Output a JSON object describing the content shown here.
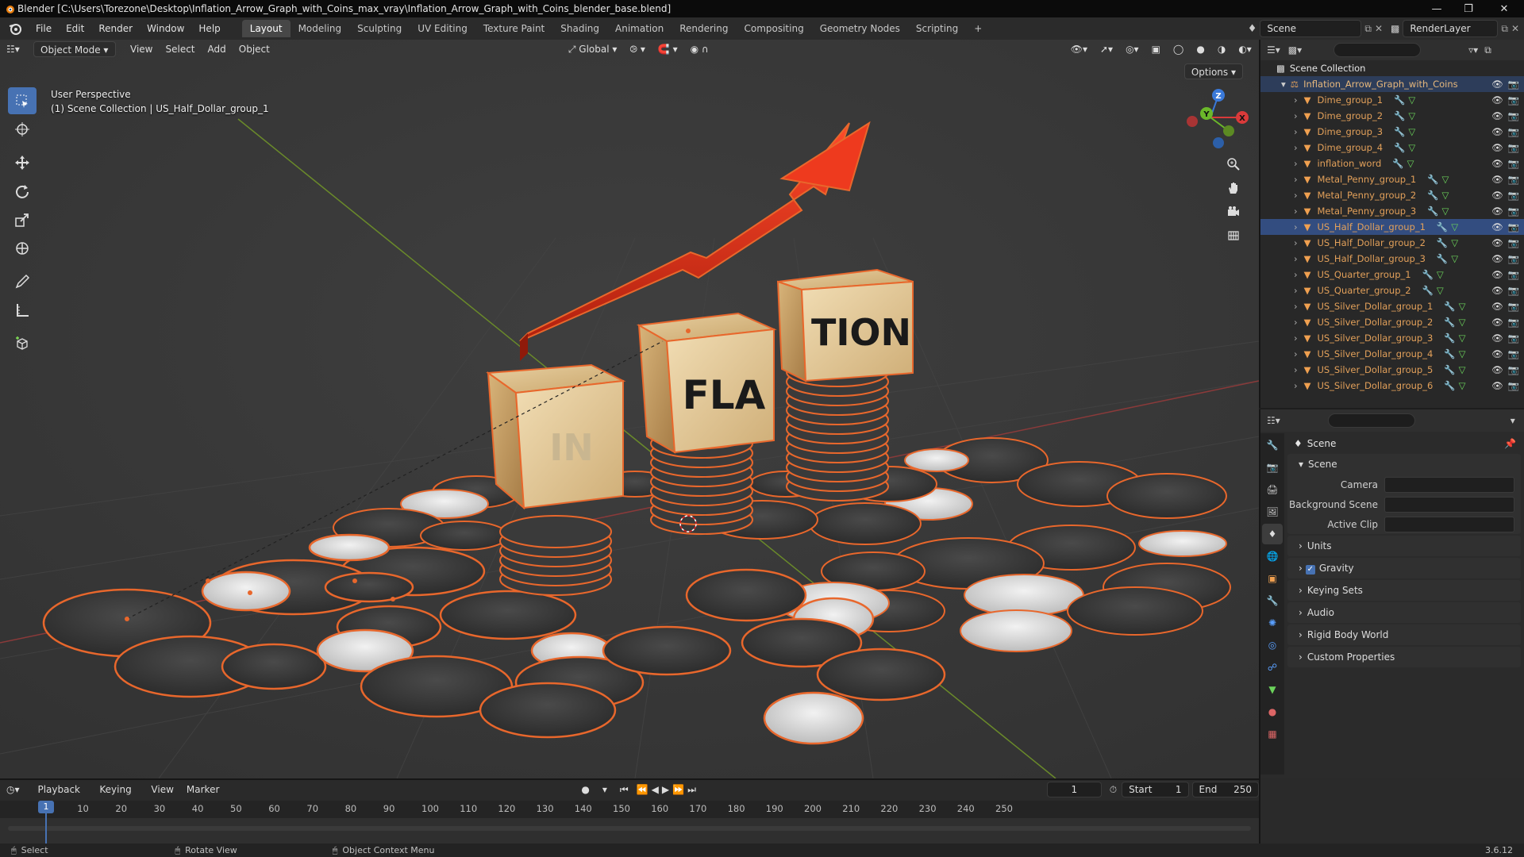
{
  "window": {
    "title": "Blender [C:\\Users\\Torezone\\Desktop\\Inflation_Arrow_Graph_with_Coins_max_vray\\Inflation_Arrow_Graph_with_Coins_blender_base.blend]"
  },
  "menus": [
    "File",
    "Edit",
    "Render",
    "Window",
    "Help"
  ],
  "workspaces": [
    "Layout",
    "Modeling",
    "Sculpting",
    "UV Editing",
    "Texture Paint",
    "Shading",
    "Animation",
    "Rendering",
    "Compositing",
    "Geometry Nodes",
    "Scripting"
  ],
  "active_workspace": "Layout",
  "scene_field": "Scene",
  "render_layer_field": "RenderLayer",
  "viewport": {
    "mode": "Object Mode",
    "menus": [
      "View",
      "Select",
      "Add",
      "Object"
    ],
    "transform": "Global",
    "options": "Options",
    "perspective": "User Perspective",
    "context": "(1) Scene Collection | US_Half_Dollar_group_1",
    "block_texts": [
      "IN",
      "FLA",
      "TION"
    ],
    "gizmo_labels": [
      "Z",
      "Y",
      "X"
    ]
  },
  "outliner": {
    "root": "Scene Collection",
    "collection": "Inflation_Arrow_Graph_with_Coins",
    "items": [
      "Dime_group_1",
      "Dime_group_2",
      "Dime_group_3",
      "Dime_group_4",
      "inflation_word",
      "Metal_Penny_group_1",
      "Metal_Penny_group_2",
      "Metal_Penny_group_3",
      "US_Half_Dollar_group_1",
      "US_Half_Dollar_group_2",
      "US_Half_Dollar_group_3",
      "US_Quarter_group_1",
      "US_Quarter_group_2",
      "US_Silver_Dollar_group_1",
      "US_Silver_Dollar_group_2",
      "US_Silver_Dollar_group_3",
      "US_Silver_Dollar_group_4",
      "US_Silver_Dollar_group_5",
      "US_Silver_Dollar_group_6"
    ],
    "selected": "US_Half_Dollar_group_1"
  },
  "properties": {
    "title": "Scene",
    "scene_panel": "Scene",
    "camera_label": "Camera",
    "background_label": "Background Scene",
    "clip_label": "Active Clip",
    "panels": [
      "Units",
      "Gravity",
      "Keying Sets",
      "Audio",
      "Rigid Body World",
      "Custom Properties"
    ]
  },
  "timeline": {
    "menus": [
      "Playback",
      "Keying",
      "View",
      "Marker"
    ],
    "current_frame": "1",
    "start_label": "Start",
    "start": "1",
    "end_label": "End",
    "end": "250",
    "ticks": [
      "10",
      "20",
      "30",
      "40",
      "50",
      "60",
      "70",
      "80",
      "90",
      "100",
      "110",
      "120",
      "130",
      "140",
      "150",
      "160",
      "170",
      "180",
      "190",
      "200",
      "210",
      "220",
      "230",
      "240",
      "250"
    ]
  },
  "statusbar": {
    "select": "Select",
    "rotate": "Rotate View",
    "context_menu": "Object Context Menu",
    "version": "3.6.12"
  }
}
